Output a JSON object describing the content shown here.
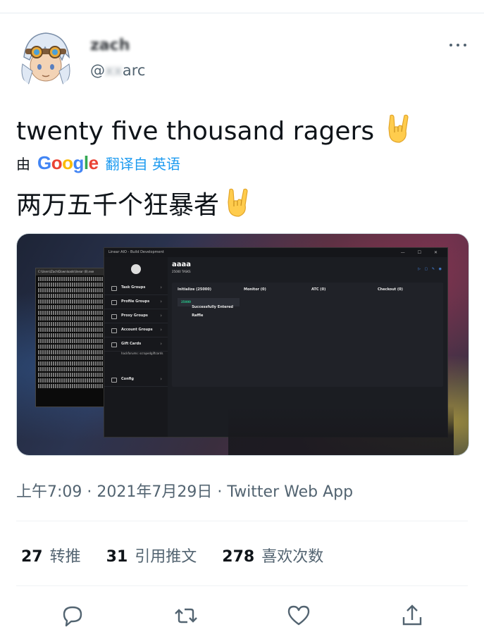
{
  "author": {
    "display_name": "zach",
    "handle_prefix": "@",
    "handle_hidden": "xx",
    "handle_suffix": "arc"
  },
  "tweet": {
    "text": "twenty five thousand ragers",
    "emoji": "🤘",
    "translation": {
      "by_label": "由",
      "provider": "Google",
      "link": "翻译自 英语",
      "text": "两万五千个狂暴者"
    }
  },
  "media": {
    "app_title": "Linear AIO - Build Development",
    "window_controls": "— ☐ ✕",
    "terminal_title": "C:\\Users\\Zach\\Downloads\\linear (8).exe",
    "sidebar": [
      {
        "label": "Task Groups"
      },
      {
        "label": "Profile Groups"
      },
      {
        "label": "Proxy Groups"
      },
      {
        "label": "Account Groups"
      },
      {
        "label": "Gift Cards"
      }
    ],
    "gift_sub": "hackforums: scrapedgiftcards",
    "config_label": "Config",
    "group_title": "aaaa",
    "group_sub": "25000 TASKS",
    "columns": [
      "Initialize (25000)",
      "Monitor (0)",
      "ATC (0)",
      "Checkout (0)"
    ],
    "status_count": "25000",
    "status_text": "Successfully Entered Raffle"
  },
  "meta": {
    "time": "上午7:09",
    "sep": "·",
    "date": "2021年7月29日",
    "source": "Twitter Web App"
  },
  "stats": [
    {
      "count": "27",
      "label": "转推"
    },
    {
      "count": "31",
      "label": "引用推文"
    },
    {
      "count": "278",
      "label": "喜欢次数"
    }
  ],
  "colors": {
    "link": "#1d9bf0",
    "secondary_text": "#536471",
    "primary_text": "#0f1419"
  },
  "icons": [
    "more-icon",
    "reply-icon",
    "retweet-icon",
    "like-icon",
    "share-icon"
  ]
}
